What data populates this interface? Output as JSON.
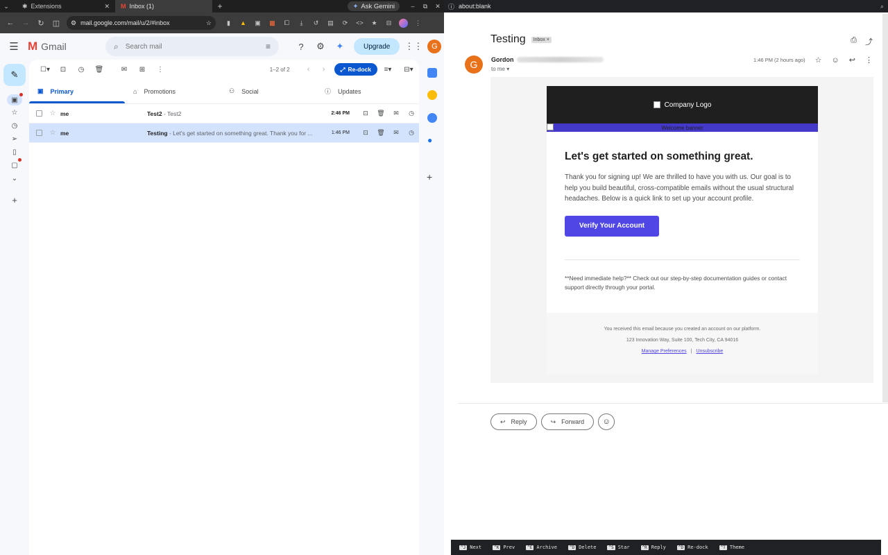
{
  "left_browser": {
    "tabs": [
      {
        "title": "Extensions",
        "icon": "puzzle-icon"
      },
      {
        "title": "Inbox (1)",
        "icon": "gmail-icon"
      }
    ],
    "ask_gemini": "Ask Gemini",
    "url": "mail.google.com/mail/u/2/#inbox"
  },
  "gmail": {
    "brand": "Gmail",
    "search_placeholder": "Search mail",
    "upgrade_label": "Upgrade",
    "avatar_letter": "G",
    "pagination": "1–2 of 2",
    "redock_label": "Re-dock",
    "categories": [
      {
        "label": "Primary",
        "icon": "inbox-icon"
      },
      {
        "label": "Promotions",
        "icon": "tag-icon"
      },
      {
        "label": "Social",
        "icon": "people-icon"
      },
      {
        "label": "Updates",
        "icon": "info-icon"
      }
    ],
    "emails": [
      {
        "sender": "me",
        "subject": "Test2",
        "snippet": " - Test2",
        "time": "2:46 PM",
        "unread": true,
        "selected": false
      },
      {
        "sender": "me",
        "subject": "Testing",
        "snippet": " - Let's get started on something great. Thank you for ...",
        "time": "1:46 PM",
        "unread": false,
        "selected": true
      }
    ]
  },
  "right_window": {
    "title": "about:blank",
    "subject": "Testing",
    "label_chip": "Inbox ×",
    "sender_name": "Gordon",
    "sender_avatar": "G",
    "to_line": "to me ▾",
    "time": "1:46 PM (2 hours ago)",
    "email": {
      "logo_alt": "Company Logo",
      "banner_alt": "Welcome banner",
      "heading": "Let's get started on something great.",
      "body": "Thank you for signing up! We are thrilled to have you with us. Our goal is to help you build beautiful, cross-compatible emails without the usual structural headaches. Below is a quick link to set up your account profile.",
      "cta": "Verify Your Account",
      "help": "**Need immediate help?** Check out our step-by-step documentation guides or contact support directly through your portal.",
      "footer_reason": "You received this email because you created an account on our platform.",
      "footer_address": "123 Innovation Way, Suite 100, Tech City, CA 94016",
      "footer_manage": "Manage Preferences",
      "footer_sep": "|",
      "footer_unsubscribe": "Unsubscribe"
    },
    "reply_label": "Reply",
    "forward_label": "Forward",
    "shortcuts": [
      {
        "key": "^J",
        "label": "Next"
      },
      {
        "key": "^K",
        "label": "Prev"
      },
      {
        "key": "^E",
        "label": "Archive"
      },
      {
        "key": "^D",
        "label": "Delete"
      },
      {
        "key": "^S",
        "label": "Star"
      },
      {
        "key": "^R",
        "label": "Reply"
      },
      {
        "key": "^D",
        "label": "Re-dock"
      },
      {
        "key": "^T",
        "label": "Theme"
      }
    ]
  },
  "colors": {
    "gmail_blue": "#0b57d0",
    "cta_indigo": "#4f46e5",
    "avatar_orange": "#e8711a"
  }
}
